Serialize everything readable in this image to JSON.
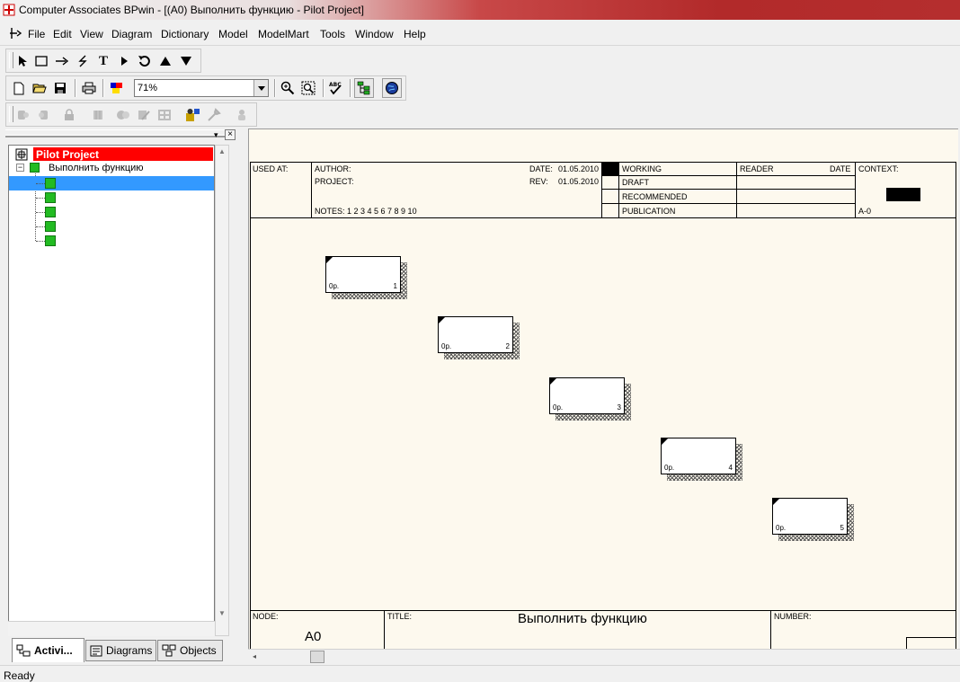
{
  "window": {
    "title": "Computer Associates BPwin - [(A0) Выполнить функцию - Pilot Project]"
  },
  "menu": {
    "items": [
      "File",
      "Edit",
      "View",
      "Diagram",
      "Dictionary",
      "Model",
      "ModelMart",
      "Tools",
      "Window",
      "Help"
    ]
  },
  "toolbar": {
    "zoom_value": "71%"
  },
  "tree": {
    "root_label": "Pilot Project",
    "child_label": "Выполнить функцию"
  },
  "tabs": [
    "Activi...",
    "Diagrams",
    "Objects"
  ],
  "frame": {
    "used_at": "USED AT:",
    "author": "AUTHOR:",
    "project": "PROJECT:",
    "notes": "NOTES:  1  2  3  4  5  6  7  8  9  10",
    "date_label": "DATE:",
    "date_value": "01.05.2010",
    "rev_label": "REV:",
    "rev_value": "01.05.2010",
    "status": [
      "WORKING",
      "DRAFT",
      "RECOMMENDED",
      "PUBLICATION"
    ],
    "reader": "READER",
    "date_col": "DATE",
    "context": "CONTEXT:",
    "context_node": "A-0",
    "node_label": "NODE:",
    "node_value": "A0",
    "title_label": "TITLE:",
    "title_value": "Выполнить функцию",
    "number_label": "NUMBER:"
  },
  "activities": [
    {
      "cost": "0р.",
      "number": "1"
    },
    {
      "cost": "0р.",
      "number": "2"
    },
    {
      "cost": "0р.",
      "number": "3"
    },
    {
      "cost": "0р.",
      "number": "4"
    },
    {
      "cost": "0р.",
      "number": "5"
    }
  ],
  "colors": {
    "tree_root_bg": "#ff0000",
    "tree_selected": "#3399ff",
    "node_icon": "#22bb22",
    "canvas_bg": "#fdf9ee"
  },
  "status": {
    "text": "Ready"
  }
}
